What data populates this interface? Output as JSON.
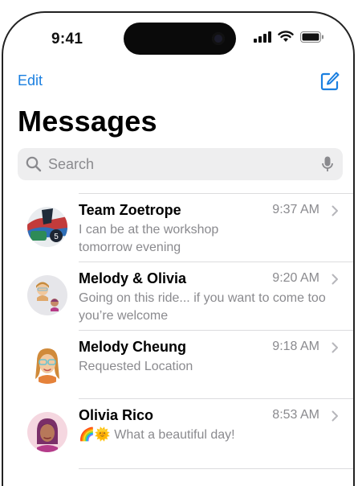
{
  "status": {
    "time": "9:41"
  },
  "nav": {
    "edit_label": "Edit",
    "title": "Messages"
  },
  "search": {
    "placeholder": "Search"
  },
  "conversations": [
    {
      "name": "Team Zoetrope",
      "time": "9:37 AM",
      "preview": "I can be at the workshop tomorrow evening"
    },
    {
      "name": "Melody & Olivia",
      "time": "9:20 AM",
      "preview": "Going on this ride... if you want to come too you’re welcome"
    },
    {
      "name": "Melody Cheung",
      "time": "9:18 AM",
      "preview": "Requested Location"
    },
    {
      "name": "Olivia Rico",
      "time": "8:53 AM",
      "preview": "🌈🌞 What a beautiful day!"
    }
  ],
  "colors": {
    "accent": "#1a7fe0",
    "secondary_text": "#8a8a8e",
    "search_bg": "#eeeeef"
  }
}
